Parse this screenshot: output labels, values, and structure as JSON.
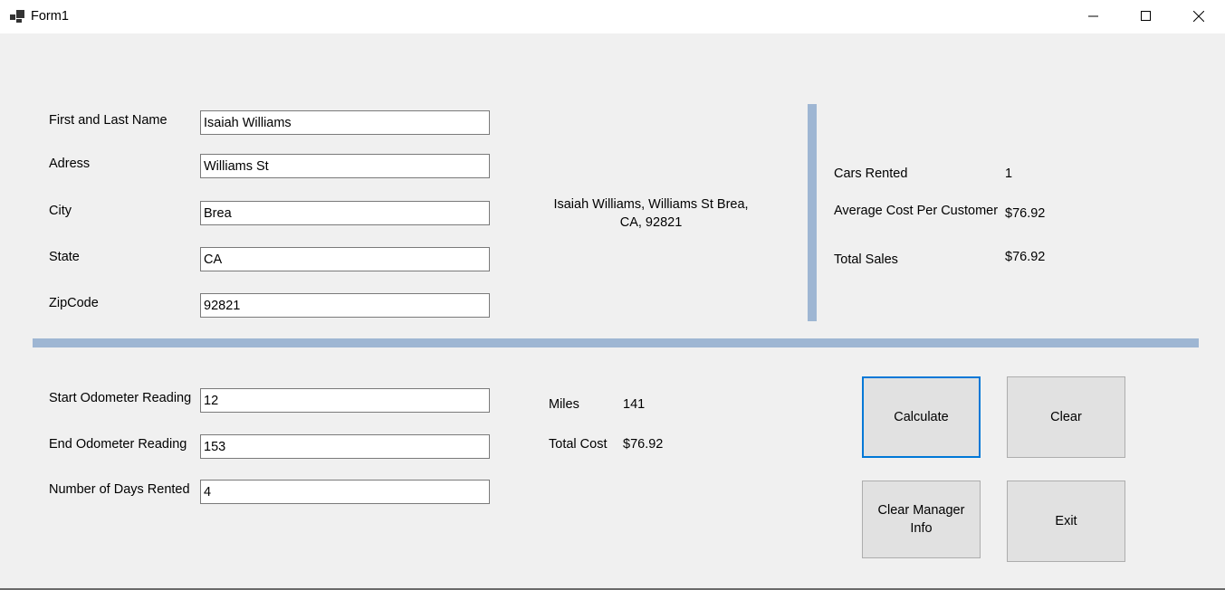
{
  "window": {
    "title": "Form1",
    "icon": "winforms-app-icon",
    "controls": [
      "minimize-icon",
      "maximize-icon",
      "close-icon"
    ]
  },
  "customer": {
    "name_label": "First and Last Name",
    "name_value": "Isaiah Williams",
    "address_label": "Adress",
    "address_value": "Williams St",
    "city_label": "City",
    "city_value": "Brea",
    "state_label": "State",
    "state_value": "CA",
    "zip_label": "ZipCode",
    "zip_value": "92821"
  },
  "address_output": "Isaiah Williams, Williams St Brea, CA, 92821",
  "manager": {
    "cars_rented_label": "Cars Rented",
    "cars_rented_value": "1",
    "avg_cost_label": "Average Cost Per Customer",
    "avg_cost_value": "$76.92",
    "total_sales_label": "Total Sales",
    "total_sales_value": "$76.92"
  },
  "rental": {
    "start_label": "Start Odometer Reading",
    "start_value": "12",
    "end_label": "End Odometer Reading",
    "end_value": "153",
    "days_label": "Number of Days Rented",
    "days_value": "4"
  },
  "results": {
    "miles_label": "Miles",
    "miles_value": "141",
    "total_cost_label": "Total Cost",
    "total_cost_value": "$76.92"
  },
  "buttons": {
    "calculate": "Calculate",
    "clear": "Clear",
    "clear_manager": "Clear Manager Info",
    "exit": "Exit"
  },
  "colors": {
    "separator": "#9eb6d3",
    "focus_border": "#0078d7",
    "background": "#f0f0f0"
  }
}
